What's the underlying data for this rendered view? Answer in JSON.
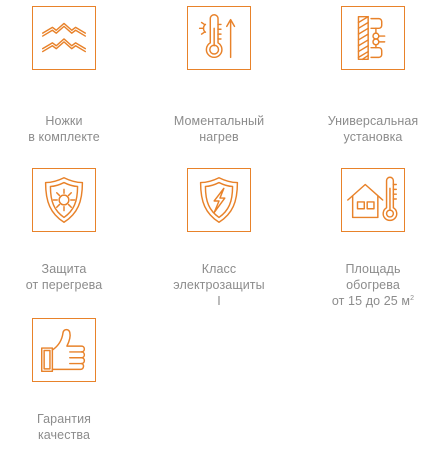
{
  "accent_color": "#e8822a",
  "text_color": "#8c8c8c",
  "features": [
    {
      "icon": "legs-icon",
      "lines": [
        "Ножки",
        "в комплекте"
      ]
    },
    {
      "icon": "thermometer-heat-icon",
      "lines": [
        "Моментальный",
        "нагрев"
      ]
    },
    {
      "icon": "wall-mount-icon",
      "lines": [
        "Универсальная",
        "установка"
      ]
    },
    {
      "icon": "sun-shield-icon",
      "lines": [
        "Защита",
        "от перегрева"
      ]
    },
    {
      "icon": "lightning-shield-icon",
      "lines": [
        "Класс",
        "электрозащиты",
        "I"
      ]
    },
    {
      "icon": "house-thermometer-icon",
      "lines": [
        "Площадь",
        "обогрева",
        "от 15 до 25 м"
      ],
      "unit_sup": "2"
    },
    {
      "icon": "thumbs-up-icon",
      "lines": [
        "Гарантия",
        "качества"
      ]
    }
  ]
}
